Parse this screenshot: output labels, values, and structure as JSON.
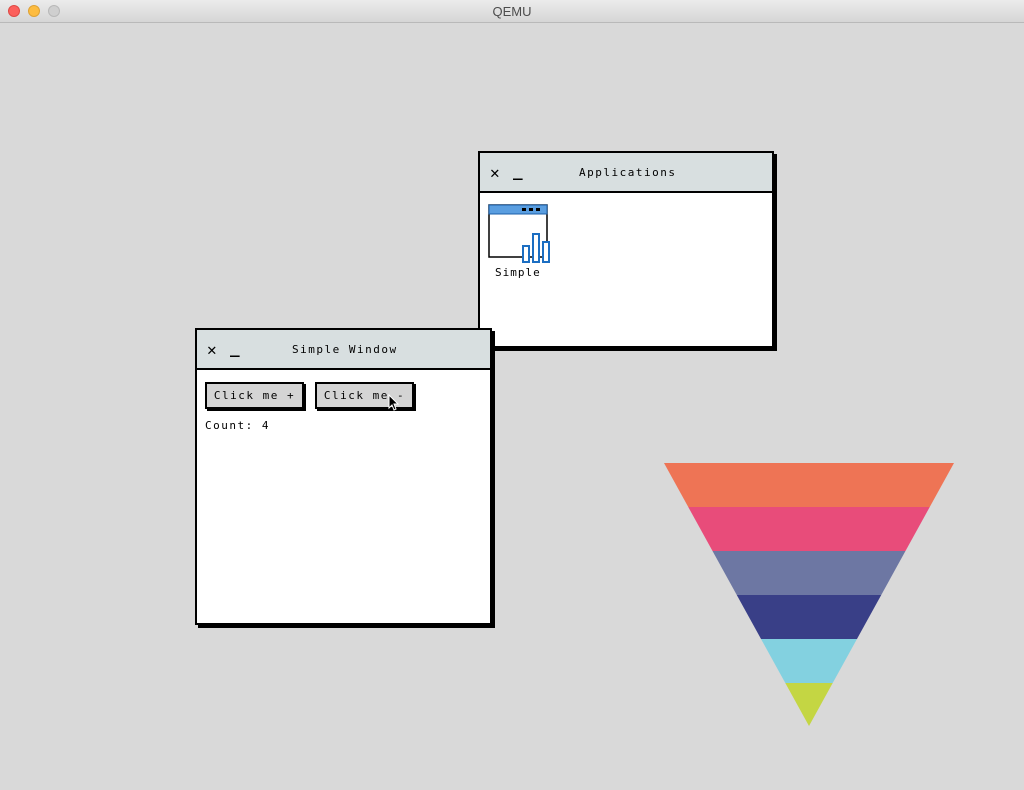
{
  "host": {
    "title": "QEMU"
  },
  "applications_window": {
    "title": "Applications",
    "close_glyph": "✕",
    "minimize_glyph": "_",
    "apps": [
      {
        "label": "Simple",
        "icon": "simple-app-icon"
      }
    ]
  },
  "simple_window": {
    "title": "Simple Window",
    "close_glyph": "✕",
    "minimize_glyph": "_",
    "increment_label": "Click me +",
    "decrement_label": "Click me -",
    "count_text": "Count: 4"
  },
  "colors": {
    "desktop": "#d9d9d9",
    "titlebar": "#d8dfe0",
    "button": "#d4d4d4",
    "logo_bands": [
      "#ee7455",
      "#e84c7a",
      "#6d77a3",
      "#393f87",
      "#83d1e0",
      "#c4d643"
    ]
  }
}
